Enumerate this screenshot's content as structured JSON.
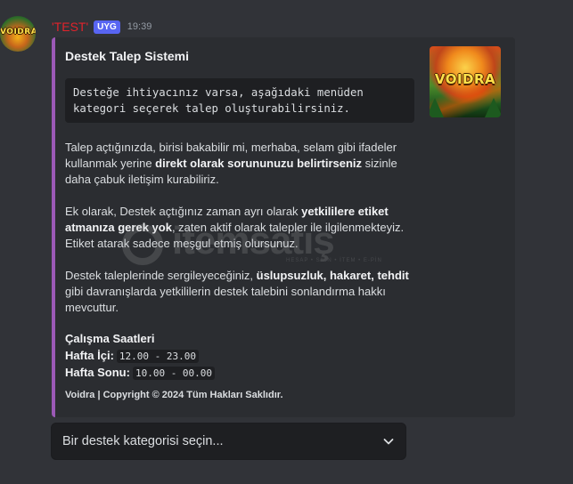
{
  "message": {
    "author": "'TEST'",
    "app_badge": "UYG",
    "timestamp": "19:39",
    "avatar_text": "VOIDRA"
  },
  "embed": {
    "accent_color": "#9b59b6",
    "title": "Destek Talep Sistemi",
    "thumbnail_text": "VOIDRA",
    "code_block": "Desteğe ihtiyacınız varsa, aşağıdaki menüden\nkategori seçerek talep oluşturabilirsiniz.",
    "para1": {
      "t1": "Talep açtığınızda, birisi bakabilir mi, merhaba, selam gibi ifadeler kullanmak yerine ",
      "b1": "direkt olarak sorununuzu belirtirseniz",
      "t2": " sizinle daha çabuk iletişim kurabiliriz."
    },
    "para2": {
      "t1": "Ek olarak, Destek açtığınız zaman ayrı olarak ",
      "b1": "yetkililere etiket atmanıza gerek yok",
      "t2": ", zaten aktif olarak talepler ile ilgilenmekteyiz. Etiket atarak sadece meşgul etmiş olursunuz."
    },
    "para3": {
      "t1": "Destek taleplerinde sergileyeceğiniz, ",
      "b1": "üslupsuzluk, hakaret, tehdit",
      "t2": " gibi davranışlarda yetkililerin destek talebini sonlandırma hakkı mevcuttur."
    },
    "hours": {
      "title": "Çalışma Saatleri",
      "weekday_label": "Hafta İçi:",
      "weekday_value": "12.00 - 23.00",
      "weekend_label": "Hafta Sonu:",
      "weekend_value": "10.00 - 00.00"
    },
    "footer": "Voidra | Copyright © 2024 Tüm Hakları Saklıdır."
  },
  "watermark": {
    "text": "itemsatış",
    "subtext": "HESAP • SKIN • İTEM • E-PİN"
  },
  "select_menu": {
    "placeholder": "Bir destek kategorisi seçin...",
    "icon": "chevron-down-icon"
  }
}
